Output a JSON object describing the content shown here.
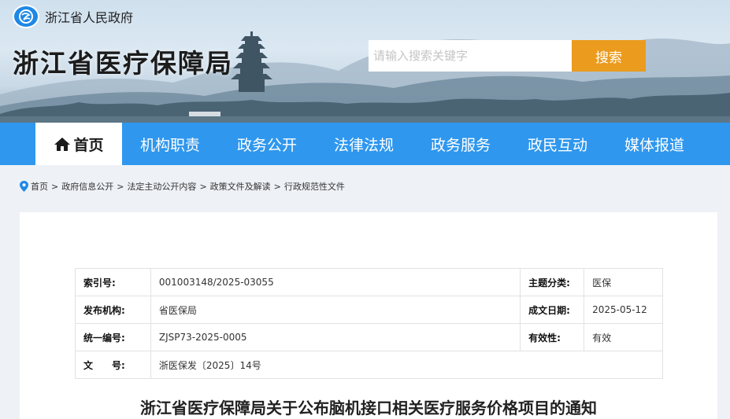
{
  "header": {
    "gov_name": "浙江省人民政府",
    "site_title": "浙江省医疗保障局",
    "search": {
      "placeholder": "请输入搜索关键字",
      "value": "",
      "button_label": "搜索"
    }
  },
  "colors": {
    "nav_bg": "#2f97ee",
    "search_button": "#eb9b1d",
    "panel_bg": "#ffffff",
    "page_bg": "#eef1f5"
  },
  "nav": {
    "items": [
      {
        "label": "首页",
        "active": true,
        "icon": "home-icon"
      },
      {
        "label": "机构职责"
      },
      {
        "label": "政务公开"
      },
      {
        "label": "法律法规"
      },
      {
        "label": "政务服务"
      },
      {
        "label": "政民互动"
      },
      {
        "label": "媒体报道"
      }
    ]
  },
  "breadcrumb": {
    "icon": "location-pin-icon",
    "items": [
      "首页",
      "政府信息公开",
      "法定主动公开内容",
      "政策文件及解读",
      "行政规范性文件"
    ],
    "separator": ">"
  },
  "meta": {
    "index_label": "索引号:",
    "index_value": "001003148/2025-03055",
    "topic_label": "主题分类:",
    "topic_value": "医保",
    "publisher_label": "发布机构:",
    "publisher_value": "省医保局",
    "date_label": "成文日期:",
    "date_value": "2025-05-12",
    "code_label": "统一编号:",
    "code_value": "ZJSP73-2025-0005",
    "validity_label": "有效性:",
    "validity_value": "有效",
    "docno_label": "文　　号:",
    "docno_value": "浙医保发〔2025〕14号"
  },
  "document": {
    "title": "浙江省医疗保障局关于公布脑机接口相关医疗服务价格项目的通知"
  }
}
